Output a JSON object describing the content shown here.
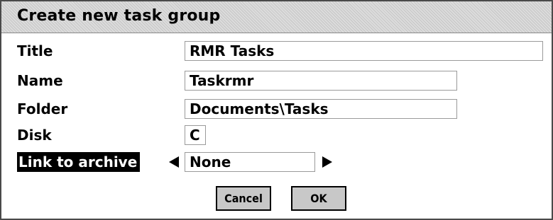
{
  "dialog": {
    "title": "Create new task group",
    "fields": {
      "title": {
        "label": "Title",
        "value": "RMR Tasks"
      },
      "name": {
        "label": "Name",
        "value": "Taskrmr"
      },
      "folder": {
        "label": "Folder",
        "value": "Documents\\Tasks"
      },
      "disk": {
        "label": "Disk",
        "value": "C"
      },
      "link_to_archive": {
        "label": "Link to archive",
        "value": "None"
      }
    },
    "buttons": {
      "cancel": "Cancel",
      "ok": "OK"
    }
  }
}
